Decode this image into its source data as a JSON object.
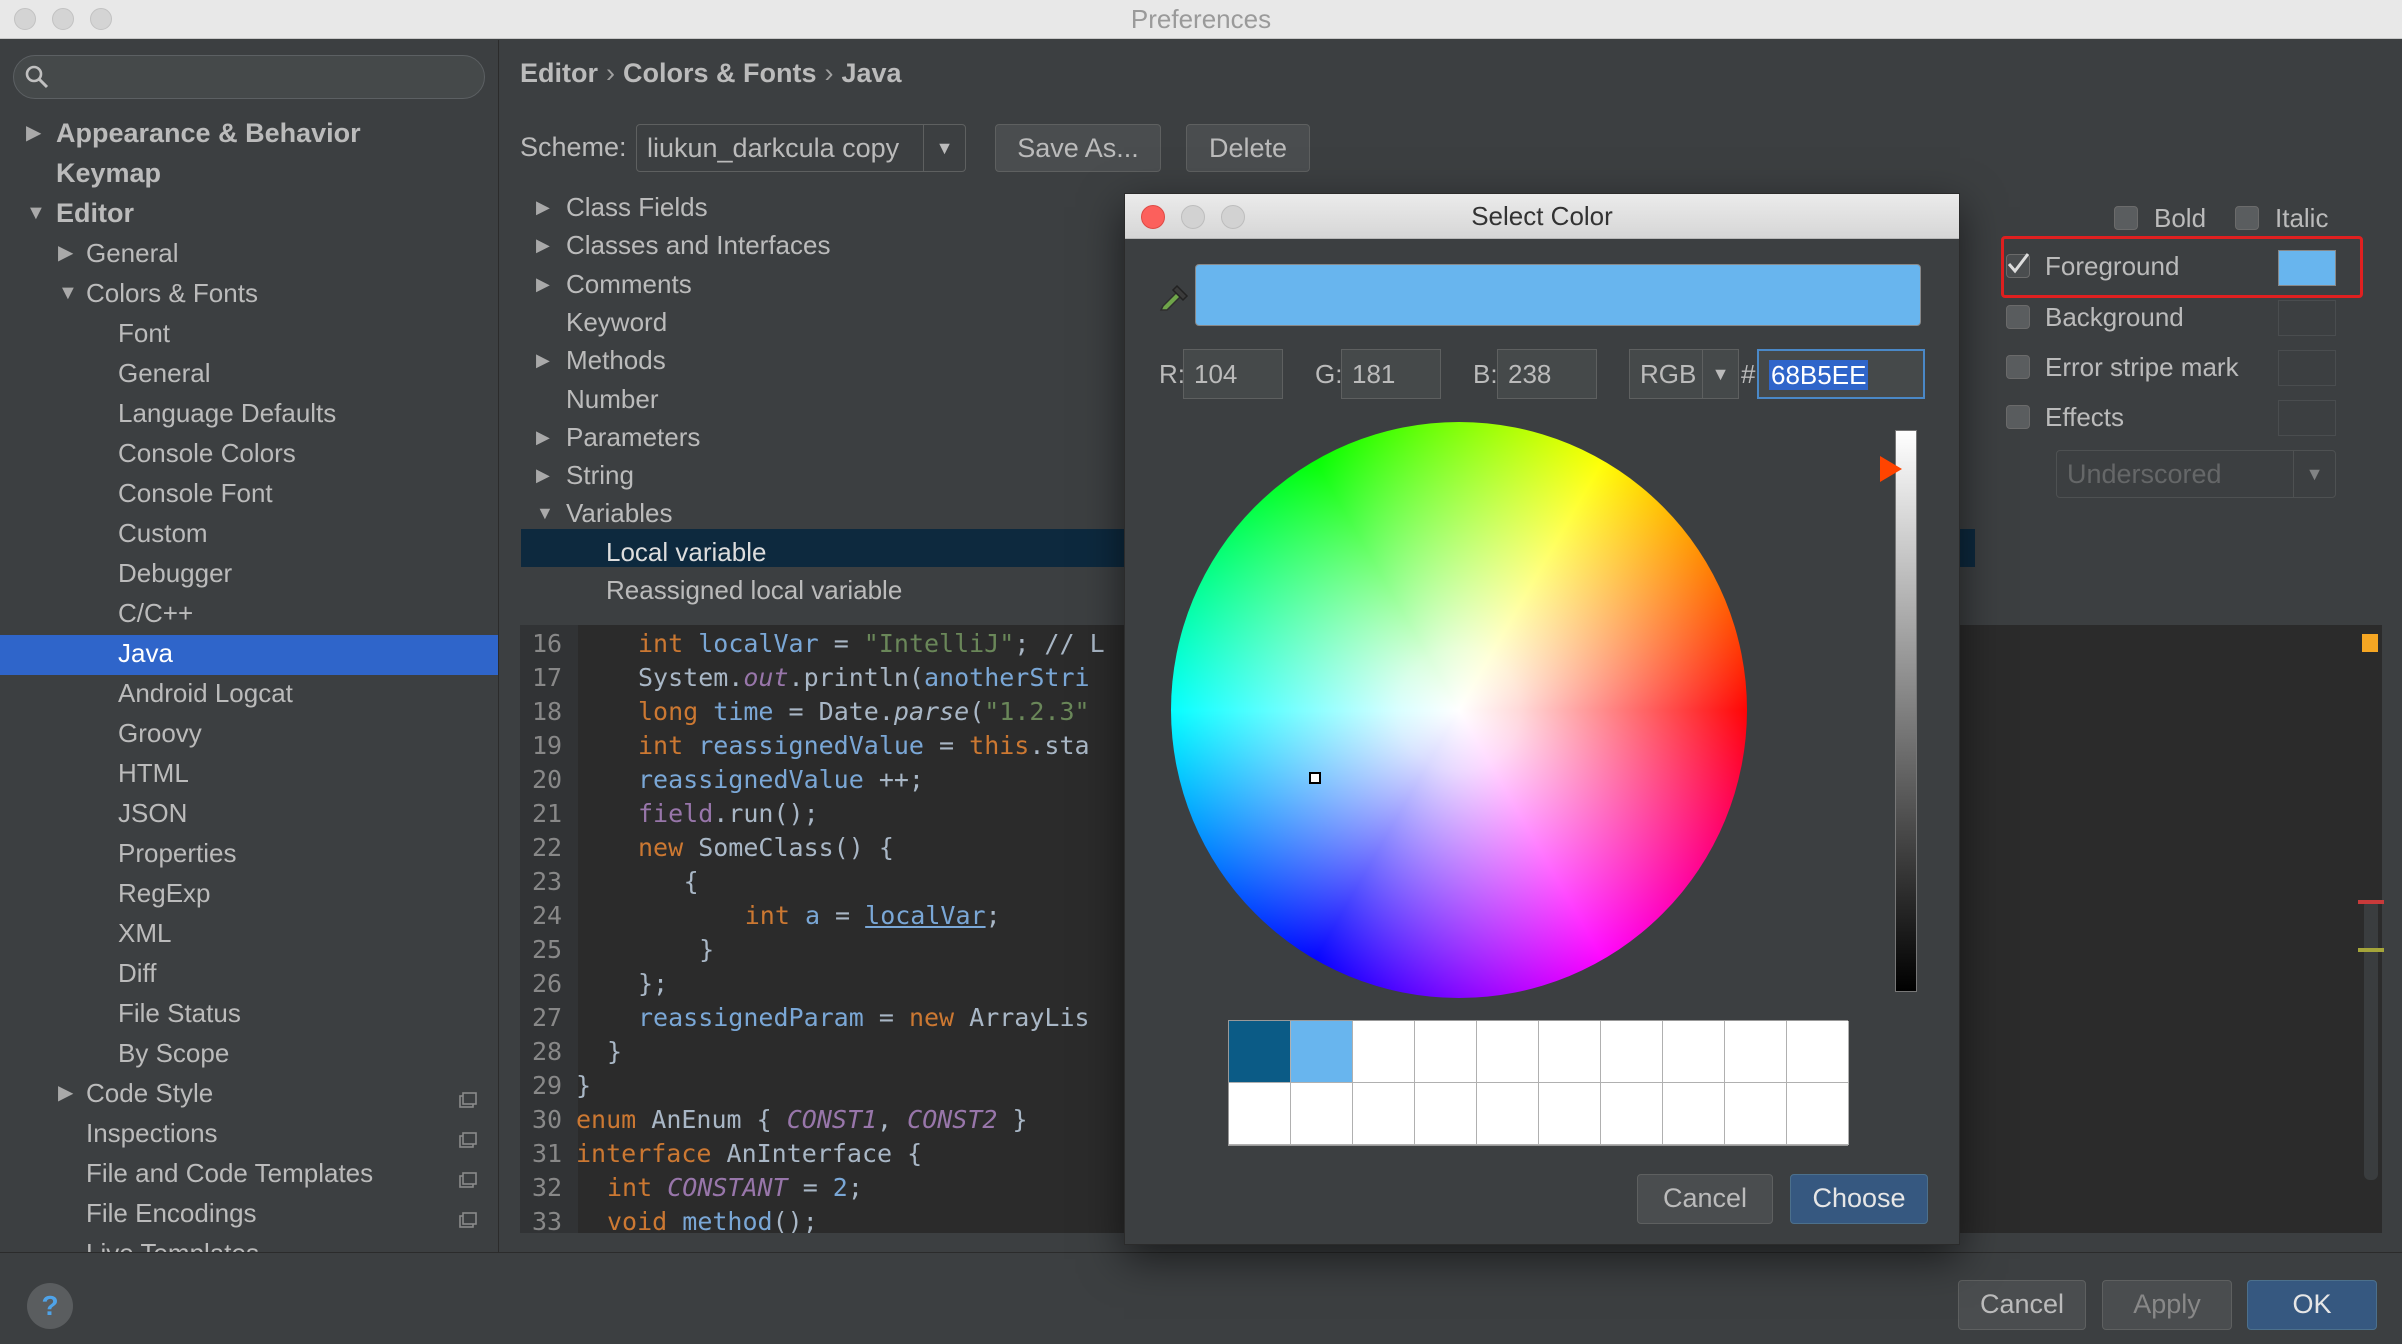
{
  "window": {
    "title": "Preferences"
  },
  "sidebar": {
    "items": [
      {
        "label": "Appearance & Behavior",
        "level": 0,
        "arrow": "▶",
        "bold": true
      },
      {
        "label": "Keymap",
        "level": 0,
        "arrow": "",
        "bold": true
      },
      {
        "label": "Editor",
        "level": 0,
        "arrow": "▼",
        "bold": true
      },
      {
        "label": "General",
        "level": 1,
        "arrow": "▶"
      },
      {
        "label": "Colors & Fonts",
        "level": 1,
        "arrow": "▼"
      },
      {
        "label": "Font",
        "level": 2
      },
      {
        "label": "General",
        "level": 2
      },
      {
        "label": "Language Defaults",
        "level": 2
      },
      {
        "label": "Console Colors",
        "level": 2
      },
      {
        "label": "Console Font",
        "level": 2
      },
      {
        "label": "Custom",
        "level": 2
      },
      {
        "label": "Debugger",
        "level": 2
      },
      {
        "label": "C/C++",
        "level": 2
      },
      {
        "label": "Java",
        "level": 2,
        "selected": true
      },
      {
        "label": "Android Logcat",
        "level": 2
      },
      {
        "label": "Groovy",
        "level": 2
      },
      {
        "label": "HTML",
        "level": 2
      },
      {
        "label": "JSON",
        "level": 2
      },
      {
        "label": "Properties",
        "level": 2
      },
      {
        "label": "RegExp",
        "level": 2
      },
      {
        "label": "XML",
        "level": 2
      },
      {
        "label": "Diff",
        "level": 2
      },
      {
        "label": "File Status",
        "level": 2
      },
      {
        "label": "By Scope",
        "level": 2
      },
      {
        "label": "Code Style",
        "level": 1,
        "arrow": "▶",
        "project": true
      },
      {
        "label": "Inspections",
        "level": 1,
        "project": true
      },
      {
        "label": "File and Code Templates",
        "level": 1,
        "project": true
      },
      {
        "label": "File Encodings",
        "level": 1,
        "project": true
      },
      {
        "label": "Live Templates",
        "level": 1
      }
    ]
  },
  "breadcrumb": [
    "Editor",
    "Colors & Fonts",
    "Java"
  ],
  "scheme": {
    "label": "Scheme:",
    "value": "liukun_darkcula copy",
    "save_as": "Save As...",
    "delete": "Delete"
  },
  "categories": [
    {
      "label": "Class Fields",
      "arrow": "▶"
    },
    {
      "label": "Classes and Interfaces",
      "arrow": "▶"
    },
    {
      "label": "Comments",
      "arrow": "▶"
    },
    {
      "label": "Keyword",
      "arrow": ""
    },
    {
      "label": "Methods",
      "arrow": "▶"
    },
    {
      "label": "Number",
      "arrow": ""
    },
    {
      "label": "Parameters",
      "arrow": "▶"
    },
    {
      "label": "String",
      "arrow": "▶"
    },
    {
      "label": "Variables",
      "arrow": "▼"
    },
    {
      "label": "Local variable",
      "arrow": "",
      "child": true,
      "selected": true
    },
    {
      "label": "Reassigned local variable",
      "arrow": "",
      "child": true
    }
  ],
  "attributes": {
    "bold": "Bold",
    "italic": "Italic",
    "foreground": "Foreground",
    "background": "Background",
    "error_stripe": "Error stripe mark",
    "effects": "Effects",
    "effect_type": "Underscored",
    "foreground_color": "#68b5ee"
  },
  "code_lines": [
    {
      "n": "16",
      "html": "<span class=\"kw\">int</span> <span class=\"var\">localVar</span> = <span class=\"str\">\"IntelliJ\"</span>; // L"
    },
    {
      "n": "17",
      "html": "System.<span class=\"fld it\">out</span>.println(<span class=\"var\">anotherStri</span>"
    },
    {
      "n": "18",
      "html": "<span class=\"kw\">long</span> <span class=\"var\">time</span> = Date.<span class=\"it\">parse</span>(<span class=\"str\">\"1.2.3\"</span>"
    },
    {
      "n": "19",
      "html": "<span class=\"kw\">int</span> <span class=\"var\">reassignedValue</span> = <span class=\"kw\">this</span>.sta"
    },
    {
      "n": "20",
      "html": "<span class=\"var\">reassignedValue</span> ++;"
    },
    {
      "n": "21",
      "html": "<span class=\"fld\">field</span>.run();"
    },
    {
      "n": "22",
      "html": "<span class=\"kw\">new</span> SomeClass() {"
    },
    {
      "n": "23",
      "html": "  {"
    },
    {
      "n": "24",
      "html": "    <span class=\"kw\">int</span> <span class=\"var\">a</span> = <span class=\"var ul\">localVar</span>;"
    },
    {
      "n": "25",
      "html": "  }"
    },
    {
      "n": "26",
      "html": "};"
    },
    {
      "n": "27",
      "html": "<span class=\"var\">reassignedParam</span> = <span class=\"kw\">new</span> ArrayLis"
    },
    {
      "n": "28",
      "html": "}"
    },
    {
      "n": "29",
      "html": "}"
    },
    {
      "n": "30",
      "html": "<span class=\"kw\">enum</span> AnEnum { <span class=\"fld it\">CONST1</span>, <span class=\"fld it\">CONST2</span> }"
    },
    {
      "n": "31",
      "html": "<span class=\"kw\">interface</span> AnInterface {"
    },
    {
      "n": "32",
      "html": "<span class=\"kw\">int</span> <span class=\"fld it\">CONSTANT</span> = <span class=\"var\">2</span>;"
    },
    {
      "n": "33",
      "html": "<span class=\"kw\">void</span> <span class=\"var\">method</span>();"
    }
  ],
  "color_dialog": {
    "title": "Select Color",
    "color": "#68b5ee",
    "r_label": "R:",
    "r": "104",
    "g_label": "G:",
    "g": "181",
    "b_label": "B:",
    "b": "238",
    "mode": "RGB",
    "hash": "#",
    "hex": "68B5EE",
    "recent": [
      "#0b5b86",
      "#68b5ee"
    ],
    "cancel": "Cancel",
    "choose": "Choose"
  },
  "footer": {
    "help": "?",
    "cancel": "Cancel",
    "apply": "Apply",
    "ok": "OK"
  }
}
